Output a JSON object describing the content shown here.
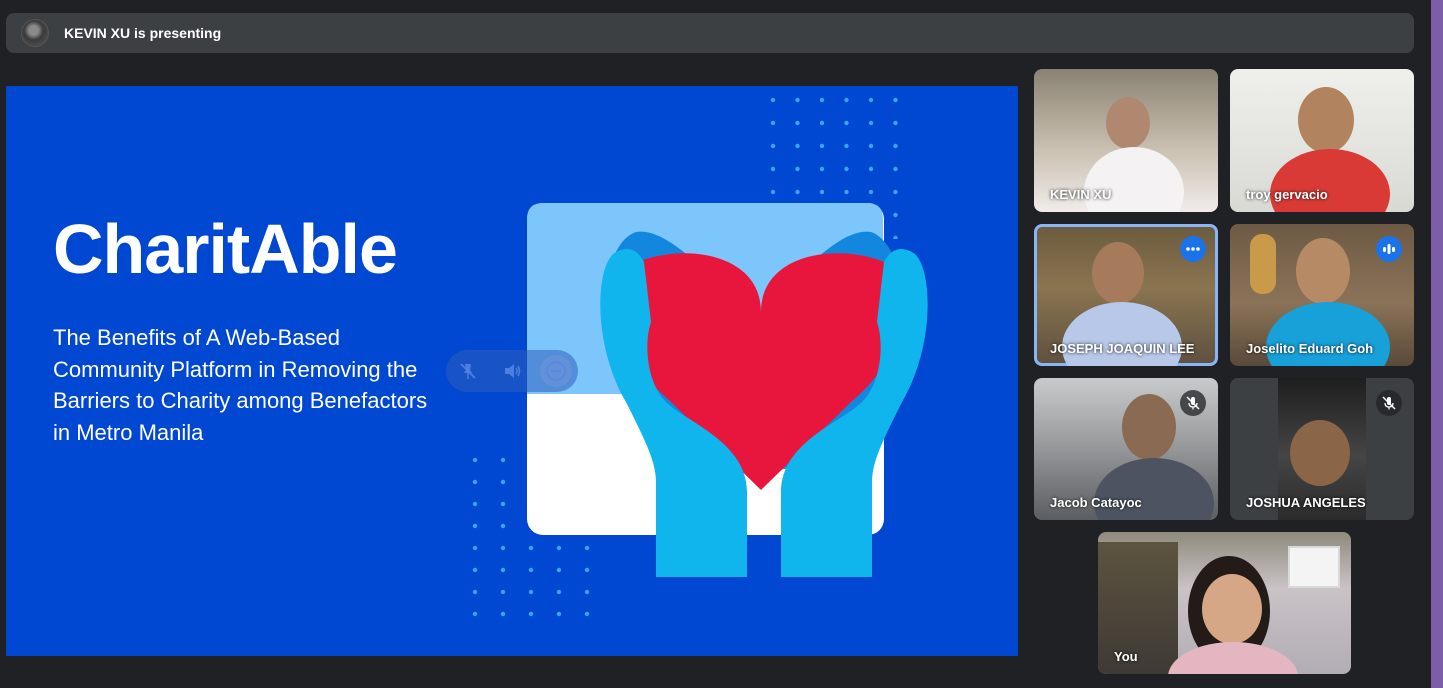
{
  "banner": {
    "text": "KEVIN XU is presenting",
    "avatar_icon": "presenter-avatar"
  },
  "slide": {
    "title": "CharitAble",
    "subtitle": "The Benefits of A Web-Based Community Platform in Removing the Barriers to Charity among Benefactors in Metro Manila",
    "background": "#0047d1",
    "illustration_icon": "hands-holding-heart-icon"
  },
  "presenter_controls": [
    {
      "icon": "unpin-icon"
    },
    {
      "icon": "volume-icon"
    },
    {
      "icon": "remove-icon"
    }
  ],
  "participants": [
    {
      "name": "KEVIN XU",
      "status": "none"
    },
    {
      "name": "troy gervacio",
      "status": "none"
    },
    {
      "name": "JOSEPH JOAQUIN LEE",
      "status": "more-options",
      "active": true
    },
    {
      "name": "Joselito Eduard Goh",
      "status": "speaking"
    },
    {
      "name": "Jacob Catayoc",
      "status": "muted"
    },
    {
      "name": "JOSHUA ANGELES",
      "status": "muted"
    },
    {
      "name": "You",
      "status": "none"
    }
  ],
  "colors": {
    "accent": "#1a73e8",
    "active_outline": "#8ab4f8",
    "heart": "#e8163c",
    "hands": "#11b5ee"
  }
}
